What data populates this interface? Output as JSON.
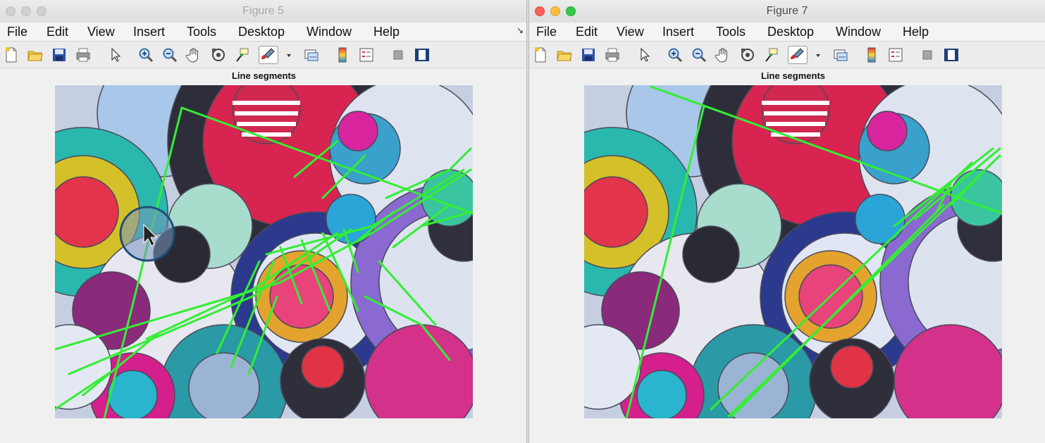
{
  "figure5": {
    "window_title": "Figure 5",
    "axes_title": "Line segments",
    "menus": [
      "File",
      "Edit",
      "View",
      "Insert",
      "Tools",
      "Desktop",
      "Window",
      "Help"
    ],
    "menu_overflow_icon": "menu-dock-arrow-icon"
  },
  "figure7": {
    "window_title": "Figure 7",
    "axes_title": "Line segments",
    "menus": [
      "File",
      "Edit",
      "View",
      "Insert",
      "Tools",
      "Desktop",
      "Window",
      "Help"
    ]
  },
  "toolbar_icons": [
    "new-figure-icon",
    "open-file-icon",
    "save-figure-icon",
    "print-figure-icon",
    "edit-plot-arrow-icon",
    "zoom-in-icon",
    "zoom-out-icon",
    "pan-hand-icon",
    "rotate-3d-icon",
    "data-cursor-icon",
    "brush-icon",
    "brush-dropdown-icon",
    "link-plot-icon",
    "insert-colorbar-icon",
    "insert-legend-icon",
    "hide-plot-tools-icon",
    "show-plot-tools-icon"
  ],
  "colors": {
    "segment_line": "#33ee33",
    "cursor_highlight": "#1f4e79",
    "close": "#fc605c",
    "minimize": "#fdbc40",
    "zoom": "#34c84a"
  }
}
